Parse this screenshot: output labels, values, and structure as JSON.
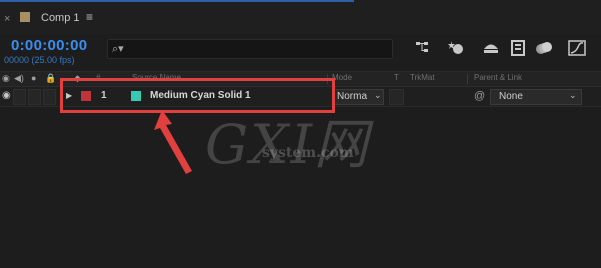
{
  "tab": {
    "close": "×",
    "comp_name": "Comp 1",
    "menu": "≡",
    "swatch_color": "#a88f63",
    "accent": "#2d5ea8"
  },
  "time": {
    "timecode": "0:00:00:00",
    "frames": "00000 (25.00 fps)"
  },
  "search": {
    "icon": "search-icon",
    "placeholder": ""
  },
  "toolbar": {
    "icons": [
      "composition-flowchart-icon",
      "draft-3d-icon",
      "shy-layers-icon",
      "frame-blending-icon",
      "motion-blur-icon",
      "graph-editor-icon"
    ]
  },
  "header": {
    "source_name": "Source Name",
    "mode": "Mode",
    "t": "T",
    "trkmat": "TrkMat",
    "parent_link": "Parent & Link"
  },
  "layer": {
    "number": "1",
    "name": "Medium Cyan Solid 1",
    "label_color": "#c0353a",
    "swatch_color": "#36c9b3",
    "mode": "Norma",
    "parent": "None"
  },
  "annotation": {
    "highlight_color": "#e2403f"
  },
  "watermark": {
    "logo": "GXI网",
    "site": "system.com"
  }
}
